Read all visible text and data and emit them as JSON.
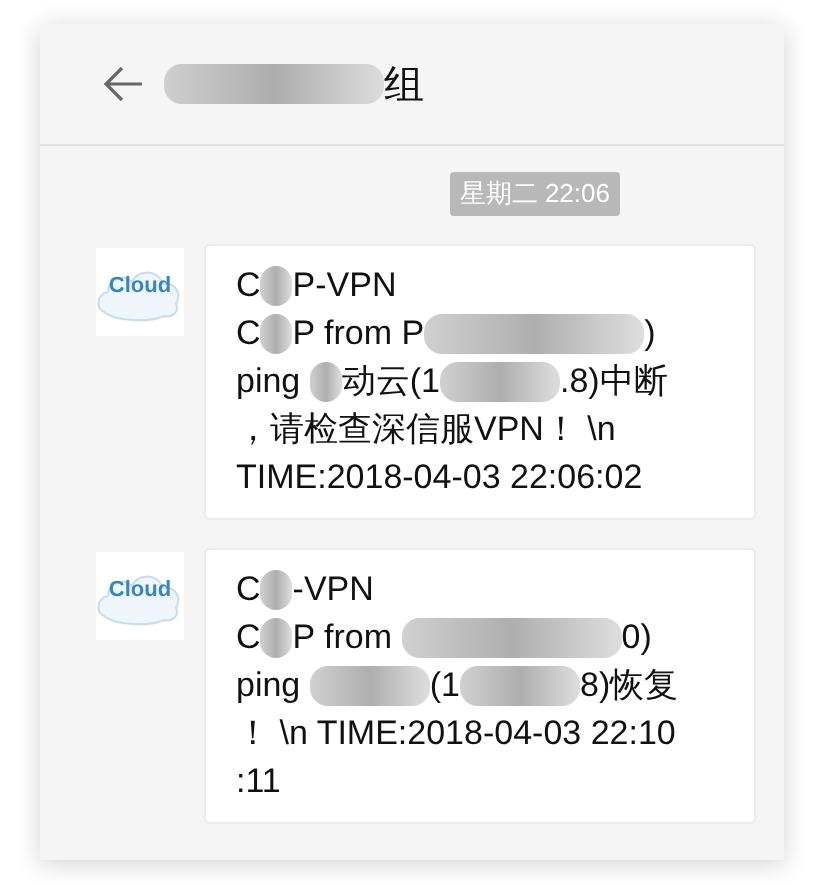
{
  "header": {
    "title": [
      {
        "kind": "redacted"
      },
      {
        "kind": "text",
        "text": "组"
      }
    ]
  },
  "time_chip": "星期二 22:06",
  "messages": [
    {
      "avatar_label": "Cloud",
      "lines": [
        [
          {
            "kind": "text",
            "text": "C"
          },
          {
            "kind": "redacted"
          },
          {
            "kind": "text",
            "text": "P-VPN"
          }
        ],
        [
          {
            "kind": "text",
            "text": "C"
          },
          {
            "kind": "redacted"
          },
          {
            "kind": "text",
            "text": "P from P"
          },
          {
            "kind": "redacted"
          },
          {
            "kind": "text",
            "text": ")"
          }
        ],
        [
          {
            "kind": "text",
            "text": "ping "
          },
          {
            "kind": "redacted"
          },
          {
            "kind": "text",
            "text": "动云(1"
          },
          {
            "kind": "redacted"
          },
          {
            "kind": "text",
            "text": ".8)中断"
          }
        ],
        [
          {
            "kind": "text",
            "text": "，请检查深信服VPN！ \\n"
          }
        ],
        [
          {
            "kind": "text",
            "text": "TIME:2018-04-03 22:06:02"
          }
        ]
      ]
    },
    {
      "avatar_label": "Cloud",
      "lines": [
        [
          {
            "kind": "text",
            "text": "C"
          },
          {
            "kind": "redacted"
          },
          {
            "kind": "text",
            "text": "-VPN"
          }
        ],
        [
          {
            "kind": "text",
            "text": "C"
          },
          {
            "kind": "redacted"
          },
          {
            "kind": "text",
            "text": "P from "
          },
          {
            "kind": "redacted"
          },
          {
            "kind": "text",
            "text": "0)"
          }
        ],
        [
          {
            "kind": "text",
            "text": "ping "
          },
          {
            "kind": "redacted"
          },
          {
            "kind": "text",
            "text": "(1"
          },
          {
            "kind": "redacted"
          },
          {
            "kind": "text",
            "text": "8)恢复"
          }
        ],
        [
          {
            "kind": "text",
            "text": "！ \\n TIME:2018-04-03 22:10"
          }
        ],
        [
          {
            "kind": "text",
            "text": ":11"
          }
        ]
      ]
    }
  ]
}
